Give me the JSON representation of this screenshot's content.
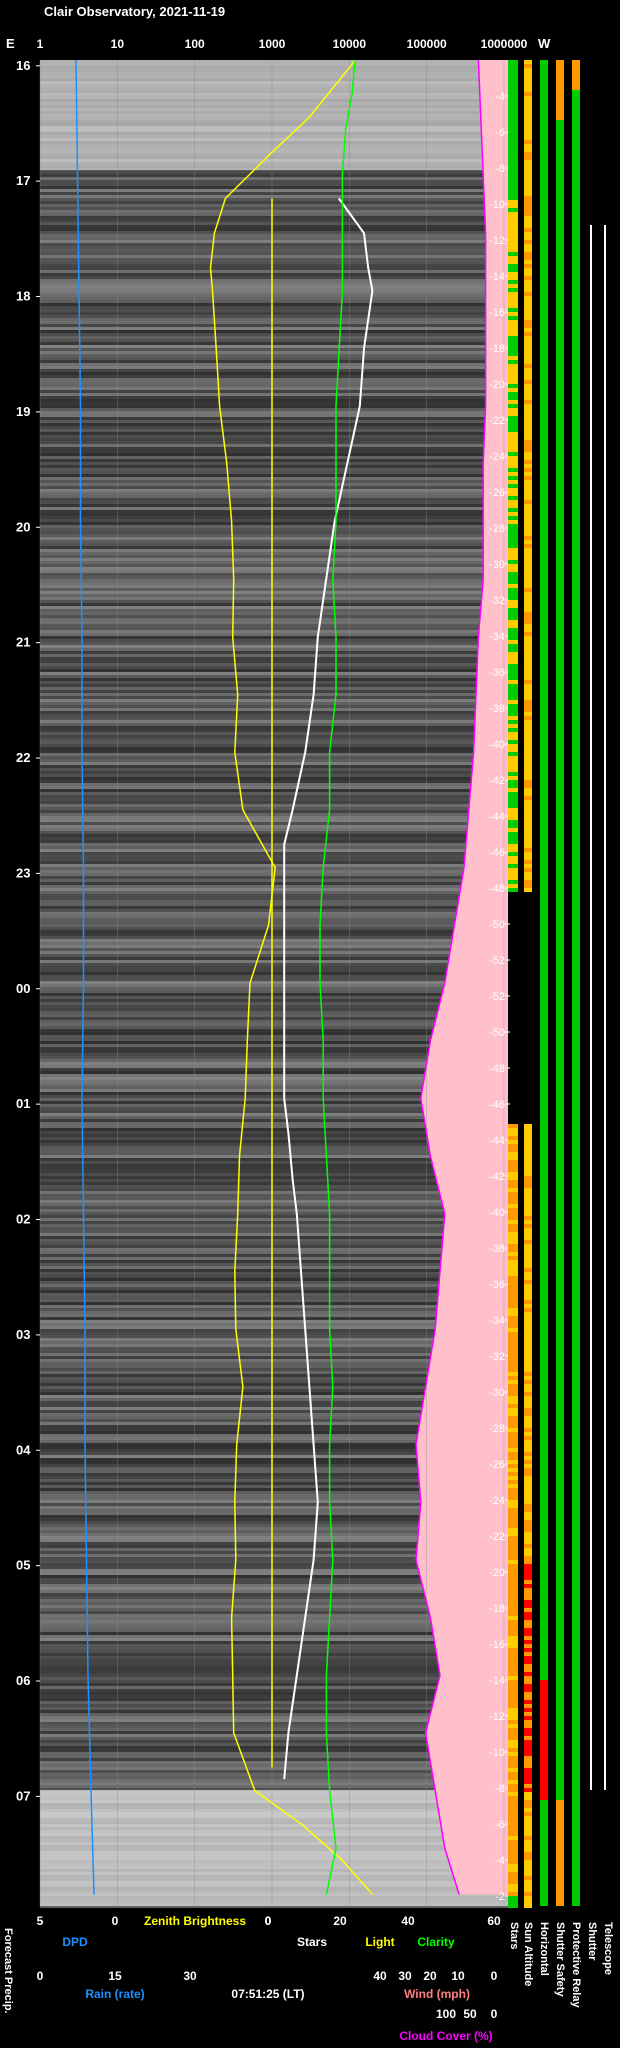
{
  "title": "Clair Observatory, 2021-11-19",
  "timestamp": "07:51:25 (LT)",
  "chart_data": {
    "type": "line",
    "top_axis": {
      "east_label": "E",
      "west_label": "W",
      "ticks": [
        "1",
        "10",
        "100",
        "1000",
        "10000",
        "100000",
        "1000000"
      ]
    },
    "time_labels": [
      "16",
      "17",
      "18",
      "19",
      "20",
      "21",
      "22",
      "23",
      "00",
      "01",
      "02",
      "03",
      "04",
      "05",
      "06",
      "07"
    ],
    "sun_altitude_labels": [
      "-4",
      "-6",
      "-8",
      "-10",
      "-12",
      "-14",
      "-16",
      "-18",
      "-20",
      "-22",
      "-24",
      "-26",
      "-28",
      "-30",
      "-32",
      "-34",
      "-36",
      "-38",
      "-40",
      "-42",
      "-44",
      "-46",
      "-48",
      "-50",
      "-52",
      "-52",
      "-50",
      "-48",
      "-46",
      "-44",
      "-42",
      "-40",
      "-38",
      "-36",
      "-34",
      "-32",
      "-30",
      "-28",
      "-26",
      "-24",
      "-22",
      "-20",
      "-18",
      "-16",
      "-14",
      "-12",
      "-10",
      "-8",
      "-6",
      "-4",
      "-2"
    ],
    "bottom_scales": [
      {
        "label": "DPD",
        "color": "#1e90ff",
        "ticks": [
          "5",
          "0"
        ]
      },
      {
        "label": "Zenith Brightness",
        "color": "#ffff00",
        "ticks": [
          "0"
        ]
      },
      {
        "label": "Stars",
        "color": "#ffffff",
        "ticks": [
          "0",
          "20"
        ]
      },
      {
        "label": "Light",
        "color": "#ffff00",
        "ticks": [
          "40"
        ]
      },
      {
        "label": "Clarity",
        "color": "#00ff00",
        "ticks": [
          "60"
        ]
      },
      {
        "label": "Rain (rate)",
        "color": "#1e90ff",
        "ticks": [
          "0",
          "15",
          "30"
        ]
      },
      {
        "label": "Wind (mph)",
        "color": "#ff7f7f",
        "ticks": [
          "40",
          "30",
          "20",
          "10",
          "0"
        ]
      },
      {
        "label": "Cloud Cover (%)",
        "color": "#ff00ff",
        "ticks": [
          "100",
          "50",
          "0"
        ]
      }
    ],
    "bottom_left_label": "Forecast Precip.",
    "status_columns": [
      "Stars",
      "Sun Altitude",
      "Horizontal",
      "Shutter Safety",
      "Protective Relay",
      "Shutter",
      "Telescope"
    ],
    "series": [
      {
        "name": "Zenith Brightness",
        "color": "#ffff00",
        "t": [
          0,
          0.5,
          0.8,
          1.0,
          1.2,
          1.5,
          1.8,
          2.0,
          2.5,
          3.0,
          3.5,
          4.0,
          4.5,
          5.0,
          5.5,
          6.0,
          6.5,
          7.0,
          7.5,
          8.0,
          8.5,
          9.0,
          9.5,
          10.0,
          10.5,
          11.0,
          11.5,
          12.0,
          12.5,
          13.0,
          13.5,
          14.0,
          14.5,
          15.0,
          15.3,
          15.6,
          15.9
        ],
        "v": [
          12000,
          3000,
          1000,
          500,
          250,
          180,
          160,
          170,
          190,
          210,
          260,
          300,
          320,
          310,
          360,
          330,
          420,
          1100,
          900,
          520,
          480,
          450,
          380,
          360,
          330,
          340,
          420,
          350,
          330,
          340,
          300,
          310,
          320,
          600,
          2500,
          8000,
          20000
        ]
      },
      {
        "name": "Stars",
        "color": "#ffffff",
        "t": [
          1.2,
          1.5,
          1.8,
          2.0,
          2.5,
          3.0,
          3.5,
          4.0,
          4.5,
          5.0,
          5.5,
          6.0,
          6.5,
          6.8,
          9.0,
          9.3,
          9.7,
          10.0,
          10.5,
          11.0,
          11.5,
          12.0,
          12.5,
          13.0,
          13.5,
          14.0,
          14.5,
          14.9
        ],
        "v": [
          14,
          20,
          21,
          22,
          20,
          19,
          16,
          13,
          11,
          9,
          8,
          6,
          3,
          1,
          1,
          2,
          3,
          4,
          5,
          6,
          7,
          8,
          9,
          8,
          6,
          4,
          2,
          1
        ]
      },
      {
        "name": "Clarity",
        "color": "#00ff00",
        "t": [
          0,
          0.3,
          0.6,
          1.0,
          1.5,
          2.0,
          2.5,
          3.0,
          3.5,
          4.0,
          4.5,
          5.0,
          5.5,
          6.0,
          6.5,
          7.0,
          7.5,
          8.0,
          8.5,
          9.0,
          9.5,
          10.0,
          10.5,
          11.0,
          11.5,
          12.0,
          12.5,
          13.0,
          13.5,
          14.0,
          14.5,
          15.0,
          15.5,
          15.9
        ],
        "v": [
          36,
          35,
          33,
          32,
          32,
          32,
          31,
          30,
          30,
          30,
          29,
          30,
          30,
          28,
          28,
          26,
          25,
          25,
          26,
          26,
          27,
          28,
          28,
          28,
          29,
          28,
          28,
          29,
          28,
          27,
          27,
          28,
          30,
          27
        ]
      },
      {
        "name": "Cloud Cover",
        "color": "#ff00ff",
        "t": [
          0,
          0.5,
          1.0,
          1.5,
          2.0,
          2.5,
          3.0,
          3.5,
          4.0,
          4.5,
          5.0,
          5.5,
          6.0,
          6.5,
          7.0,
          7.5,
          8.0,
          8.5,
          9.0,
          9.5,
          10.0,
          10.5,
          11.0,
          11.5,
          12.0,
          12.5,
          13.0,
          13.5,
          14.0,
          14.5,
          15.0,
          15.5,
          15.9
        ],
        "v": [
          4,
          3,
          2,
          1,
          1,
          1,
          1,
          2,
          2,
          2,
          4,
          5,
          6,
          8,
          10,
          14,
          18,
          24,
          28,
          24,
          18,
          20,
          22,
          26,
          30,
          28,
          30,
          24,
          20,
          26,
          22,
          18,
          12
        ]
      },
      {
        "name": "DPD",
        "color": "#1e90ff",
        "t": [
          0,
          1,
          2,
          3,
          4,
          5,
          6,
          7,
          8,
          9,
          10,
          11,
          12,
          13,
          14,
          15,
          15.9
        ],
        "v": [
          2.6,
          2.5,
          2.4,
          2.3,
          2.3,
          2.2,
          2.2,
          2.1,
          2.1,
          2.2,
          2.1,
          2.0,
          2.0,
          1.9,
          1.8,
          1.6,
          1.4
        ]
      }
    ]
  }
}
